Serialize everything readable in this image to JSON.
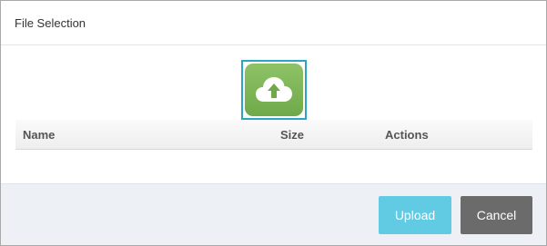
{
  "dialog": {
    "title": "File Selection"
  },
  "upload_zone": {
    "icon": "cloud-upload-icon",
    "icon_color": "#7cb356",
    "border_color": "#2aa6c4"
  },
  "table": {
    "columns": [
      "Name",
      "Size",
      "Actions"
    ],
    "rows": []
  },
  "footer": {
    "upload_label": "Upload",
    "cancel_label": "Cancel",
    "upload_color": "#62cbe4",
    "cancel_color": "#6b6b6b"
  }
}
